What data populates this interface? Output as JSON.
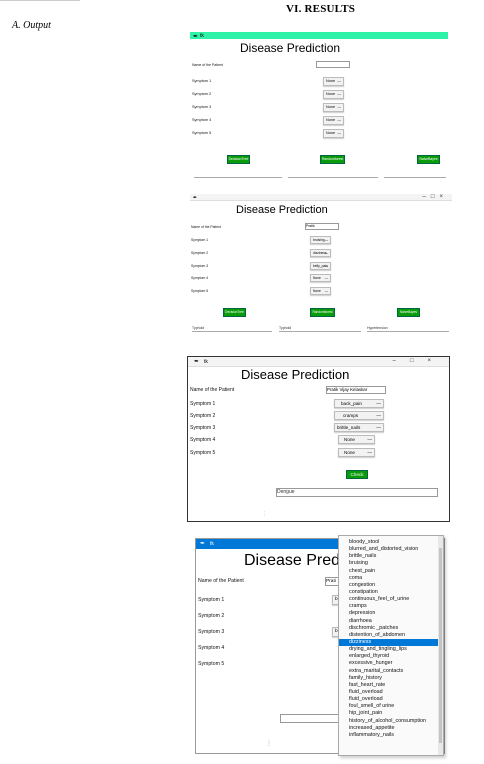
{
  "section_heading": "VI.    RESULTS",
  "subsection_heading": "A.    Output",
  "app_title": "Disease Prediction",
  "window_icon": "feather-icon",
  "window_name": "tk",
  "name_label": "Name of the Patient",
  "symptom_labels": [
    "Symptom 1",
    "Symptom 2",
    "Symptom 3",
    "Symptom 4",
    "Symptom 5"
  ],
  "buttons": {
    "decision_tree": "DecisionTree",
    "random_forest": "Randomforest",
    "naive_bayes": "NaiveBayes",
    "check": "Check"
  },
  "windows": [
    {
      "patient_name": "",
      "symptoms": [
        "None",
        "None",
        "None",
        "None",
        "None"
      ],
      "outputs": [
        "",
        "",
        ""
      ]
    },
    {
      "patient_name": "Pratik",
      "symptoms": [
        "bruising",
        "dizziness",
        "belly_pain",
        "None",
        "None"
      ],
      "outputs": [
        "Typhoid",
        "Typhoid",
        "Hypertension"
      ]
    },
    {
      "patient_name": "Pratik Vijay Kelaskar",
      "symptoms": [
        "back_pain",
        "cramps",
        "brittle_nails",
        "None",
        "None"
      ],
      "outputs": [
        "Dengue"
      ]
    },
    {
      "patient_name": "Prati",
      "symptoms": [
        "b",
        "",
        "b",
        "",
        ""
      ]
    }
  ],
  "dropdown": {
    "selected": "dizziness",
    "options": [
      "bloody_stool",
      "blurred_and_distorted_vision",
      "brittle_nails",
      "bruising",
      "chest_pain",
      "coma",
      "congestion",
      "constipation",
      "continuous_feel_of_urine",
      "cramps",
      "depression",
      "diarrhoea",
      "dischromic _patches",
      "distention_of_abdomen",
      "dizziness",
      "drying_and_tingling_lips",
      "enlarged_thyroid",
      "excessive_hunger",
      "extra_marital_contacts",
      "family_history",
      "fast_heart_rate",
      "fluid_overload",
      "fluid_overload",
      "foul_smell_of urine",
      "hip_joint_pain",
      "history_of_alcohol_consumption",
      "increased_appetite",
      "inflammatory_nails"
    ]
  },
  "colors": {
    "title_green": "#2ef2a8",
    "title_blue": "#0078d7",
    "button_green": "#0a9b0a",
    "selection_blue": "#0078d7"
  }
}
